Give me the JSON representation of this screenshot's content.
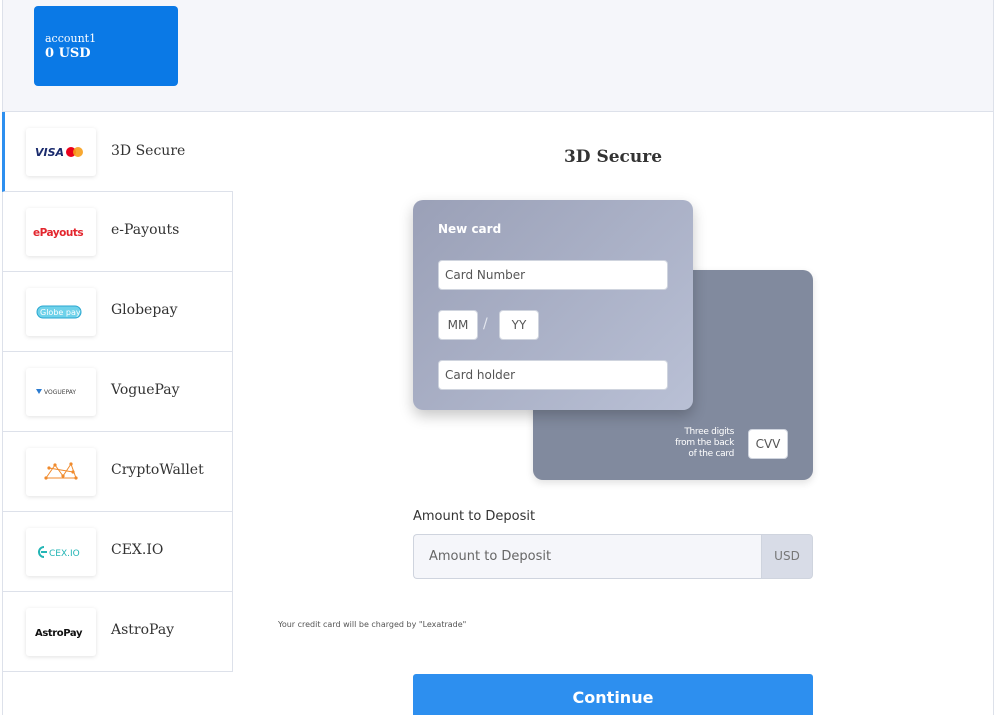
{
  "account": {
    "name": "account1",
    "balance": "0 USD"
  },
  "methods": [
    {
      "label": "3D Secure",
      "icon": "visa-mastercard-logo",
      "active": true
    },
    {
      "label": "e-Payouts",
      "icon": "e-payouts-logo",
      "logo_text": "ePayouts"
    },
    {
      "label": "Globepay",
      "icon": "globepay-logo",
      "logo_text": "Globe pay"
    },
    {
      "label": "VoguePay",
      "icon": "voguepay-logo",
      "logo_text": "VOGUEPAY"
    },
    {
      "label": "CryptoWallet",
      "icon": "cryptowallet-logo"
    },
    {
      "label": "CEX.IO",
      "icon": "cexio-logo",
      "logo_text": "CEX.IO"
    },
    {
      "label": "AstroPay",
      "icon": "astropay-logo",
      "logo_text": "AstroPay"
    }
  ],
  "main": {
    "title": "3D Secure",
    "card": {
      "title": "New card",
      "number_placeholder": "Card Number",
      "month_placeholder": "MM",
      "year_placeholder": "YY",
      "separator": "/",
      "holder_placeholder": "Card holder",
      "cvv_hint_lines": [
        "Three digits",
        "from the back",
        "of the card"
      ],
      "cvv_placeholder": "CVV"
    },
    "amount_label": "Amount to Deposit",
    "amount_placeholder": "Amount to Deposit",
    "currency": "USD",
    "charge_note": "Your credit card will be charged by \"Lexatrade\"",
    "continue_label": "Continue"
  },
  "colors": {
    "accent": "#2d8fef",
    "account_tile": "#0a79e6",
    "card_front": "#a9b0c7",
    "card_back": "#818a9e"
  }
}
